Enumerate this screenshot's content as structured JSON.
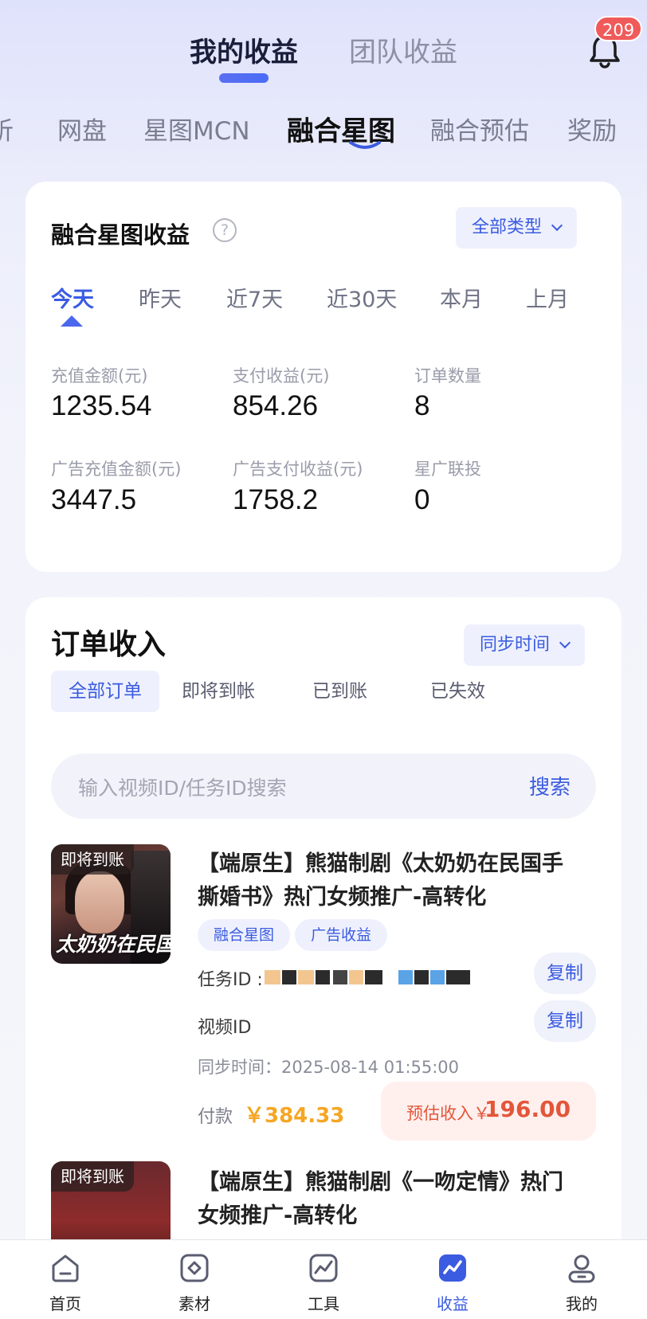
{
  "header": {
    "tabs": [
      {
        "label": "我的收益",
        "active": true
      },
      {
        "label": "团队收益",
        "active": false
      }
    ],
    "notification_count": "209"
  },
  "sub_tabs": [
    {
      "label": "析"
    },
    {
      "label": "网盘"
    },
    {
      "label": "星图MCN"
    },
    {
      "label": "融合星图",
      "active": true
    },
    {
      "label": "融合预估"
    },
    {
      "label": "奖励"
    }
  ],
  "income_card": {
    "title": "融合星图收益",
    "help_glyph": "?",
    "type_select": "全部类型",
    "periods": [
      "今天",
      "昨天",
      "近7天",
      "近30天",
      "本月",
      "上月"
    ],
    "active_period": "今天",
    "stats": [
      {
        "label": "充值金额(元)",
        "value": "1235.54"
      },
      {
        "label": "支付收益(元)",
        "value": "854.26"
      },
      {
        "label": "订单数量",
        "value": "8"
      },
      {
        "label": "广告充值金额(元)",
        "value": "3447.5"
      },
      {
        "label": "广告支付收益(元)",
        "value": "1758.2"
      },
      {
        "label": "星广联投",
        "value": "0"
      }
    ]
  },
  "orders": {
    "title": "订单收入",
    "sort_select": "同步时间",
    "tabs": [
      "全部订单",
      "即将到帐",
      "已到账",
      "已失效"
    ],
    "active_tab": "全部订单",
    "search": {
      "placeholder": "输入视频ID/任务ID搜索",
      "button": "搜索"
    },
    "items": [
      {
        "status_badge": "即将到账",
        "thumb_caption": "太奶奶在民国",
        "title": "【端原生】熊猫制剧《太奶奶在民国手撕婚书》热门女频推广-高转化",
        "tags": [
          "融合星图",
          "广告收益"
        ],
        "task_id_label": "任务ID :",
        "video_id_label": "视频ID",
        "copy_label": "复制",
        "sync_time": "同步时间：2025-08-14 01:55:00",
        "pay_label": "付款",
        "pay_amount": "￥384.33",
        "est_label": "预估收入￥",
        "est_amount": "196.00"
      },
      {
        "status_badge": "即将到账",
        "title": "【端原生】熊猫制剧《一吻定情》热门女频推广-高转化"
      }
    ]
  },
  "bottom_nav": [
    {
      "label": "首页",
      "icon": "home-icon"
    },
    {
      "label": "素材",
      "icon": "material-icon"
    },
    {
      "label": "工具",
      "icon": "tools-icon"
    },
    {
      "label": "收益",
      "icon": "earnings-icon",
      "active": true
    },
    {
      "label": "我的",
      "icon": "profile-icon"
    }
  ],
  "colors": {
    "accent": "#3b5be0",
    "badge": "#f05a5a",
    "pay": "#f5a623",
    "estimate": "#e3563a"
  }
}
